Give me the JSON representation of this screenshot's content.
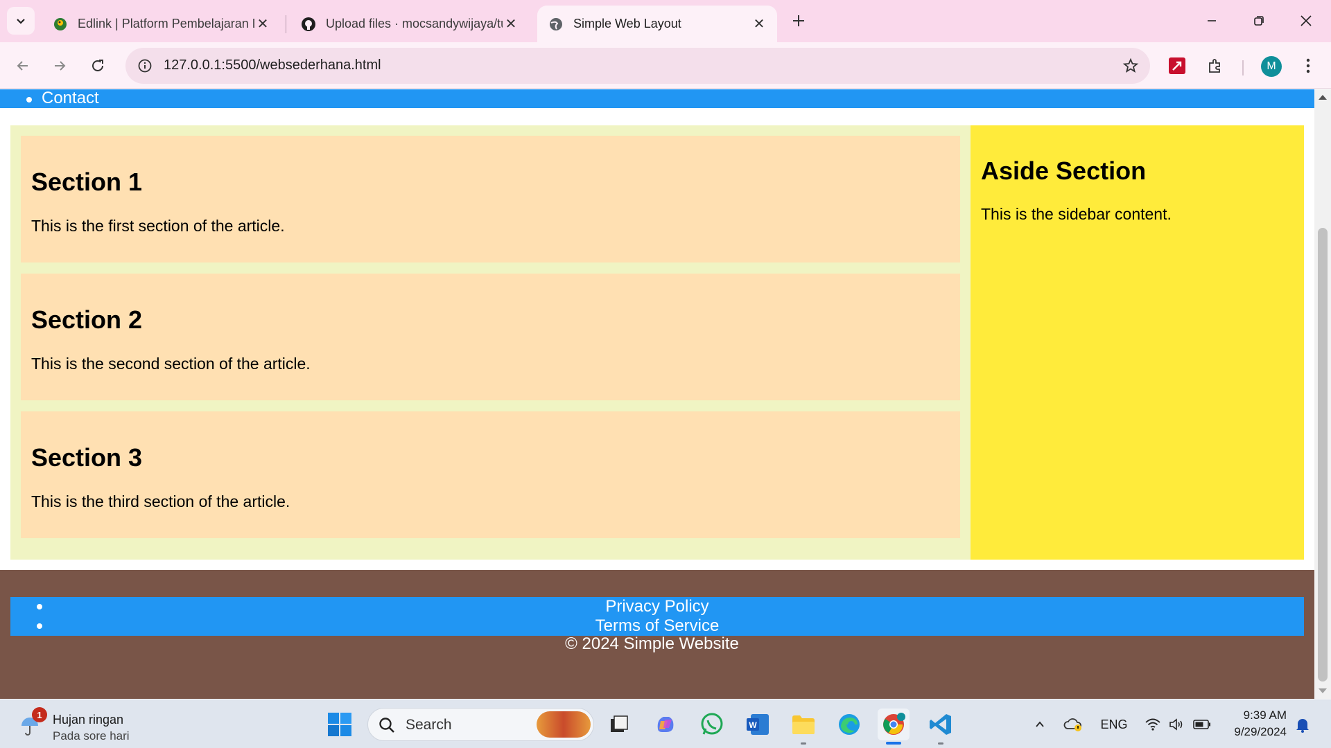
{
  "browser": {
    "tabs": [
      {
        "title": "Edlink | Platform Pembelajaran Digital",
        "favicon": "edlink-icon",
        "active": false
      },
      {
        "title": "Upload files · mocsandywijaya/tugas",
        "favicon": "github-icon",
        "active": false
      },
      {
        "title": "Simple Web Layout",
        "favicon": "globe-icon",
        "active": true
      }
    ],
    "url": "127.0.0.1:5500/websederhana.html",
    "profile_initial": "M",
    "accent_color": "#fad9ec"
  },
  "page": {
    "nav_items": [
      "Contact"
    ],
    "sections": [
      {
        "title": "Section 1",
        "text": "This is the first section of the article."
      },
      {
        "title": "Section 2",
        "text": "This is the second section of the article."
      },
      {
        "title": "Section 3",
        "text": "This is the third section of the article."
      }
    ],
    "aside": {
      "title": "Aside Section",
      "text": "This is the sidebar content."
    },
    "footer": {
      "links": [
        "Privacy Policy",
        "Terms of Service"
      ],
      "copyright": "© 2024 Simple Website"
    },
    "colors": {
      "nav": "#2196f3",
      "main": "#f0f4c3",
      "section": "#ffe0b2",
      "aside": "#ffeb3b",
      "footer": "#795548"
    }
  },
  "taskbar": {
    "weather": {
      "badge": "1",
      "condition": "Hujan ringan",
      "subtitle": "Pada sore hari"
    },
    "search_placeholder": "Search",
    "language": "ENG",
    "time": "9:39 AM",
    "date": "9/29/2024",
    "pinned_apps": [
      "file-explorer-app",
      "copilot",
      "whatsapp",
      "word",
      "folder",
      "edge",
      "chrome",
      "vscode"
    ]
  }
}
